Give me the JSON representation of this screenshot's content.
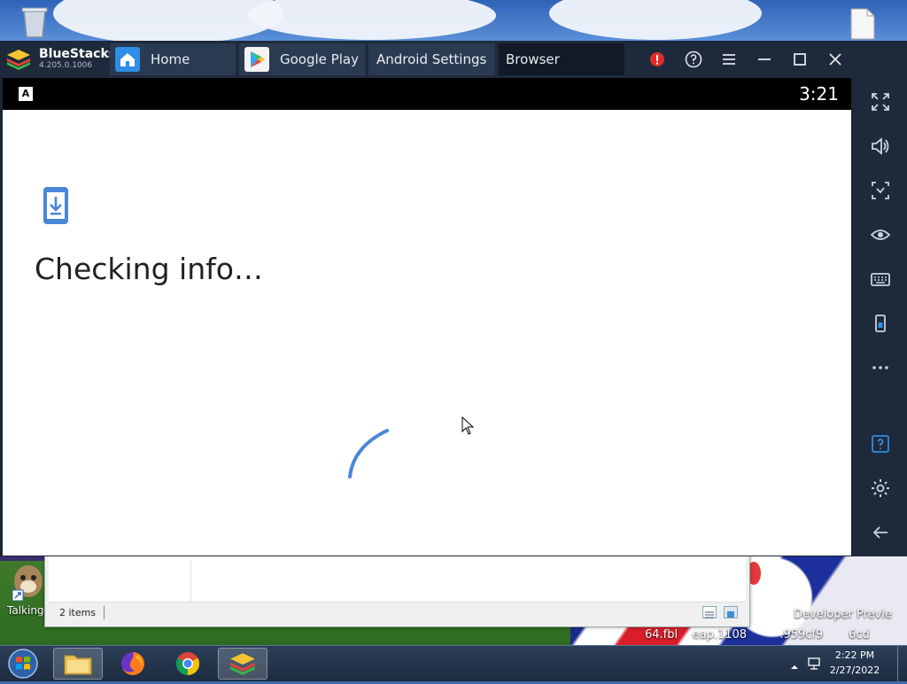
{
  "app": {
    "name": "BlueStacks",
    "version": "4.205.0.1006"
  },
  "tabs": [
    {
      "label": "Home",
      "icon": "home-icon"
    },
    {
      "label": "Google Play",
      "icon": "play-store-icon"
    },
    {
      "label": "Android Settings"
    },
    {
      "label": "Browser"
    }
  ],
  "window_controls": [
    "alert-icon",
    "help-icon",
    "menu-icon",
    "minimize-icon",
    "maximize-icon",
    "close-icon",
    "collapse-sidebar-icon"
  ],
  "android": {
    "status_letter": "A",
    "clock": "3:21",
    "message": "Checking info…",
    "icon": "phone-download-icon",
    "accent": "#4a86d8"
  },
  "sidebar_tools": [
    "fullscreen-icon",
    "volume-icon",
    "screen-capture-icon",
    "eye-icon",
    "keyboard-icon",
    "shake-icon",
    "more-icon",
    "help-icon",
    "settings-icon",
    "back-icon"
  ],
  "explorer": {
    "status": "2 items"
  },
  "desktop": {
    "icon_label": "Talking",
    "wall_text_1": "Developer Previe",
    "wall_text_2": "64.fbl    eap.1108         .959cf9       6cd"
  },
  "taskbar": {
    "time": "2:22 PM",
    "date": "2/27/2022",
    "apps": [
      "file-explorer-icon",
      "firefox-icon",
      "chrome-icon",
      "bluestacks-icon"
    ]
  },
  "colors": {
    "titlebar": "#1e2a3b",
    "tab_bg": "#2a3a50",
    "alert": "#e02b2b",
    "spinner": "#4a86d8"
  }
}
